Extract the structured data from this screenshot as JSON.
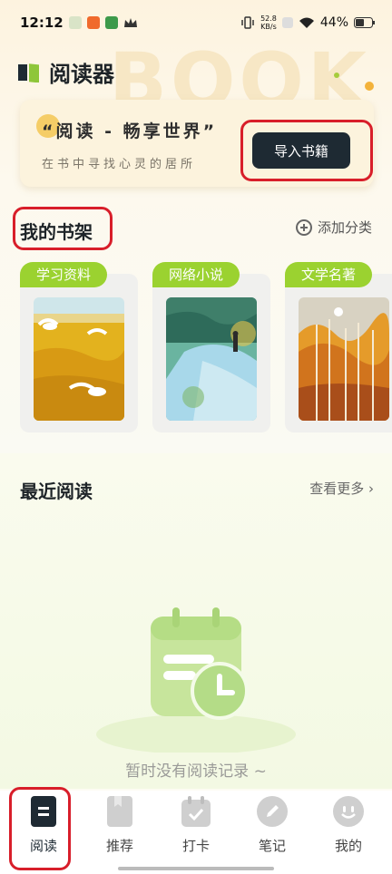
{
  "status_bar": {
    "time": "12:12",
    "net_speed_value": "52.8",
    "net_speed_unit": "KB/s",
    "battery": "44%"
  },
  "header": {
    "title": "阅读器",
    "bg_word": "BOOK"
  },
  "banner": {
    "quote": "“阅读 - 畅享世界”",
    "subtitle": "在书中寻找心灵的居所",
    "import_button": "导入书籍"
  },
  "shelf": {
    "title": "我的书架",
    "add_category": "添加分类",
    "categories": [
      {
        "label": "学习资料"
      },
      {
        "label": "网络小说"
      },
      {
        "label": "文学名著"
      }
    ]
  },
  "recent": {
    "title": "最近阅读",
    "more": "查看更多",
    "empty": "暂时没有阅读记录 ~"
  },
  "tabs": [
    {
      "label": "阅读",
      "icon": "book-icon",
      "active": true
    },
    {
      "label": "推荐",
      "icon": "bookmark-book-icon",
      "active": false
    },
    {
      "label": "打卡",
      "icon": "calendar-check-icon",
      "active": false
    },
    {
      "label": "笔记",
      "icon": "pencil-icon",
      "active": false
    },
    {
      "label": "我的",
      "icon": "profile-icon",
      "active": false
    }
  ],
  "colors": {
    "accent_green": "#9bd230",
    "button_dark": "#1e2a33",
    "highlight_red": "#d81e2a"
  }
}
